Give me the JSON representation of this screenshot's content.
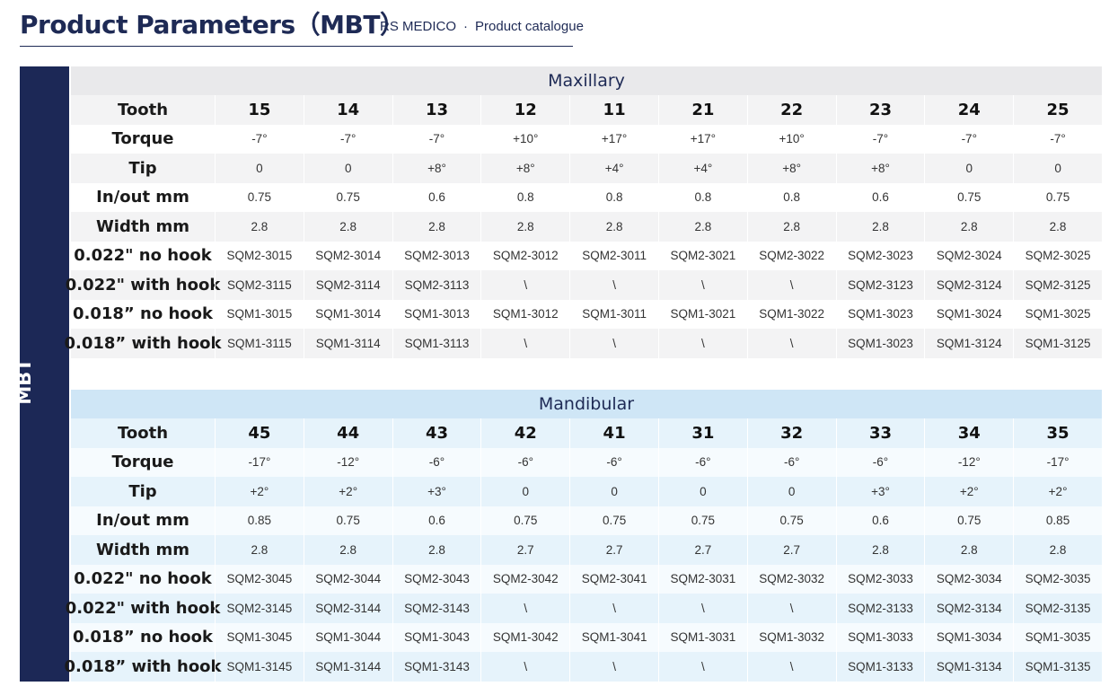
{
  "header": {
    "title": "Product Parameters（MBT）",
    "brand": "RS MEDICO",
    "separator": "·",
    "catalogue": "Product catalogue"
  },
  "side_label": "MBT",
  "maxillary": {
    "title": "Maxillary",
    "rows": [
      {
        "label": "Tooth",
        "values": [
          "15",
          "14",
          "13",
          "12",
          "11",
          "21",
          "22",
          "23",
          "24",
          "25"
        ]
      },
      {
        "label": "Torque",
        "values": [
          "-7°",
          "-7°",
          "-7°",
          "+10°",
          "+17°",
          "+17°",
          "+10°",
          "-7°",
          "-7°",
          "-7°"
        ]
      },
      {
        "label": "Tip",
        "values": [
          "0",
          "0",
          "+8°",
          "+8°",
          "+4°",
          "+4°",
          "+8°",
          "+8°",
          "0",
          "0"
        ]
      },
      {
        "label": "In/out mm",
        "values": [
          "0.75",
          "0.75",
          "0.6",
          "0.8",
          "0.8",
          "0.8",
          "0.8",
          "0.6",
          "0.75",
          "0.75"
        ]
      },
      {
        "label": "Width mm",
        "values": [
          "2.8",
          "2.8",
          "2.8",
          "2.8",
          "2.8",
          "2.8",
          "2.8",
          "2.8",
          "2.8",
          "2.8"
        ]
      },
      {
        "label": "0.022\" no hook",
        "values": [
          "SQM2-3015",
          "SQM2-3014",
          "SQM2-3013",
          "SQM2-3012",
          "SQM2-3011",
          "SQM2-3021",
          "SQM2-3022",
          "SQM2-3023",
          "SQM2-3024",
          "SQM2-3025"
        ]
      },
      {
        "label": "0.022\" with hook",
        "values": [
          "SQM2-3115",
          "SQM2-3114",
          "SQM2-3113",
          "\\",
          "\\",
          "\\",
          "\\",
          "SQM2-3123",
          "SQM2-3124",
          "SQM2-3125"
        ]
      },
      {
        "label": "0.018” no hook",
        "values": [
          "SQM1-3015",
          "SQM1-3014",
          "SQM1-3013",
          "SQM1-3012",
          "SQM1-3011",
          "SQM1-3021",
          "SQM1-3022",
          "SQM1-3023",
          "SQM1-3024",
          "SQM1-3025"
        ]
      },
      {
        "label": "0.018” with hook",
        "values": [
          "SQM1-3115",
          "SQM1-3114",
          "SQM1-3113",
          "\\",
          "\\",
          "\\",
          "\\",
          "SQM1-3023",
          "SQM1-3124",
          "SQM1-3125"
        ]
      }
    ]
  },
  "mandibular": {
    "title": "Mandibular",
    "rows": [
      {
        "label": "Tooth",
        "values": [
          "45",
          "44",
          "43",
          "42",
          "41",
          "31",
          "32",
          "33",
          "34",
          "35"
        ]
      },
      {
        "label": "Torque",
        "values": [
          "-17°",
          "-12°",
          "-6°",
          "-6°",
          "-6°",
          "-6°",
          "-6°",
          "-6°",
          "-12°",
          "-17°"
        ]
      },
      {
        "label": "Tip",
        "values": [
          "+2°",
          "+2°",
          "+3°",
          "0",
          "0",
          "0",
          "0",
          "+3°",
          "+2°",
          "+2°"
        ]
      },
      {
        "label": "In/out mm",
        "values": [
          "0.85",
          "0.75",
          "0.6",
          "0.75",
          "0.75",
          "0.75",
          "0.75",
          "0.6",
          "0.75",
          "0.85"
        ]
      },
      {
        "label": "Width mm",
        "values": [
          "2.8",
          "2.8",
          "2.8",
          "2.7",
          "2.7",
          "2.7",
          "2.7",
          "2.8",
          "2.8",
          "2.8"
        ]
      },
      {
        "label": "0.022\" no hook",
        "values": [
          "SQM2-3045",
          "SQM2-3044",
          "SQM2-3043",
          "SQM2-3042",
          "SQM2-3041",
          "SQM2-3031",
          "SQM2-3032",
          "SQM2-3033",
          "SQM2-3034",
          "SQM2-3035"
        ]
      },
      {
        "label": "0.022\" with hook",
        "values": [
          "SQM2-3145",
          "SQM2-3144",
          "SQM2-3143",
          "\\",
          "\\",
          "\\",
          "\\",
          "SQM2-3133",
          "SQM2-3134",
          "SQM2-3135"
        ]
      },
      {
        "label": "0.018” no hook",
        "values": [
          "SQM1-3045",
          "SQM1-3044",
          "SQM1-3043",
          "SQM1-3042",
          "SQM1-3041",
          "SQM1-3031",
          "SQM1-3032",
          "SQM1-3033",
          "SQM1-3034",
          "SQM1-3035"
        ]
      },
      {
        "label": "0.018” with hook",
        "values": [
          "SQM1-3145",
          "SQM1-3144",
          "SQM1-3143",
          "\\",
          "\\",
          "\\",
          "\\",
          "SQM1-3133",
          "SQM1-3134",
          "SQM1-3135"
        ]
      }
    ]
  }
}
